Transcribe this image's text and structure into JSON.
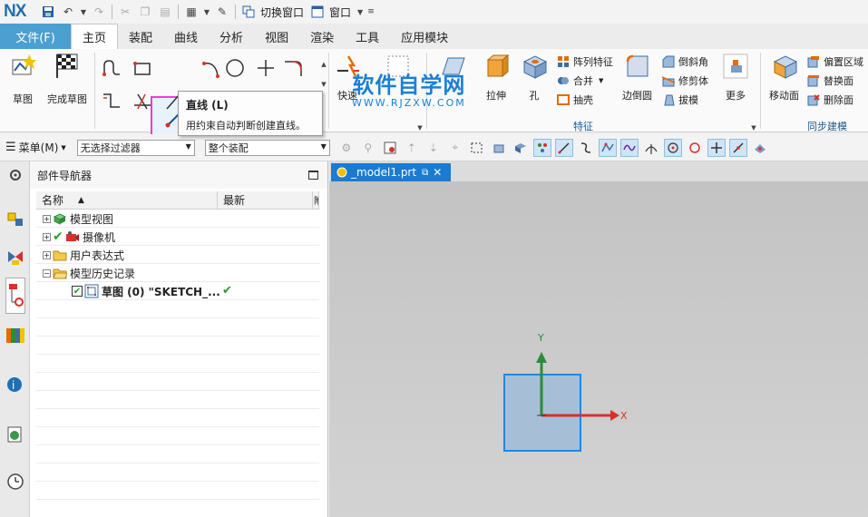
{
  "app": {
    "logo": "NX"
  },
  "quick_access": {
    "switch_window": "切换窗口",
    "window": "窗口"
  },
  "tabs": {
    "file": "文件(F)",
    "items": [
      "主页",
      "装配",
      "曲线",
      "分析",
      "视图",
      "渲染",
      "工具",
      "应用模块"
    ]
  },
  "ribbon": {
    "sketch": "草图",
    "finish_sketch": "完成草图",
    "quick": "快速",
    "extrude": "拉伸",
    "hole": "孔",
    "pattern_feature": "阵列特征",
    "merge": "合并",
    "shell": "抽壳",
    "edge_blend": "边倒圆",
    "chamfer": "倒斜角",
    "trim_body": "修剪体",
    "draft": "拔模",
    "more": "更多",
    "move_face": "移动面",
    "offset_region": "偏置区域",
    "replace_face": "替换面",
    "delete_face": "删除面",
    "group_feature": "特征",
    "group_sync": "同步建模"
  },
  "watermark": {
    "title": "软件自学网",
    "url": "WWW.RJZXW.COM"
  },
  "tooltip": {
    "title": "直线 (L)",
    "desc": "用约束自动判断创建直线。"
  },
  "selection_bar": {
    "menu": "菜单(M)",
    "filter": "无选择过滤器",
    "scope": "整个装配"
  },
  "navigator": {
    "title": "部件导航器",
    "col_name": "名称",
    "col_latest": "最新",
    "col_extra": "附",
    "items": [
      {
        "label": "模型视图"
      },
      {
        "label": "摄像机"
      },
      {
        "label": "用户表达式"
      },
      {
        "label": "模型历史记录"
      },
      {
        "label": "草图 (0) \"SKETCH_..."
      }
    ]
  },
  "graphics": {
    "tab": "_model1.prt",
    "axis_x": "X",
    "axis_y": "Y"
  },
  "colors": {
    "accent": "#4b9fd1",
    "tab_blue": "#1b7bd0",
    "highlight": "#e83edb",
    "axis_x": "#d9302c",
    "axis_y": "#2e8b3a"
  }
}
